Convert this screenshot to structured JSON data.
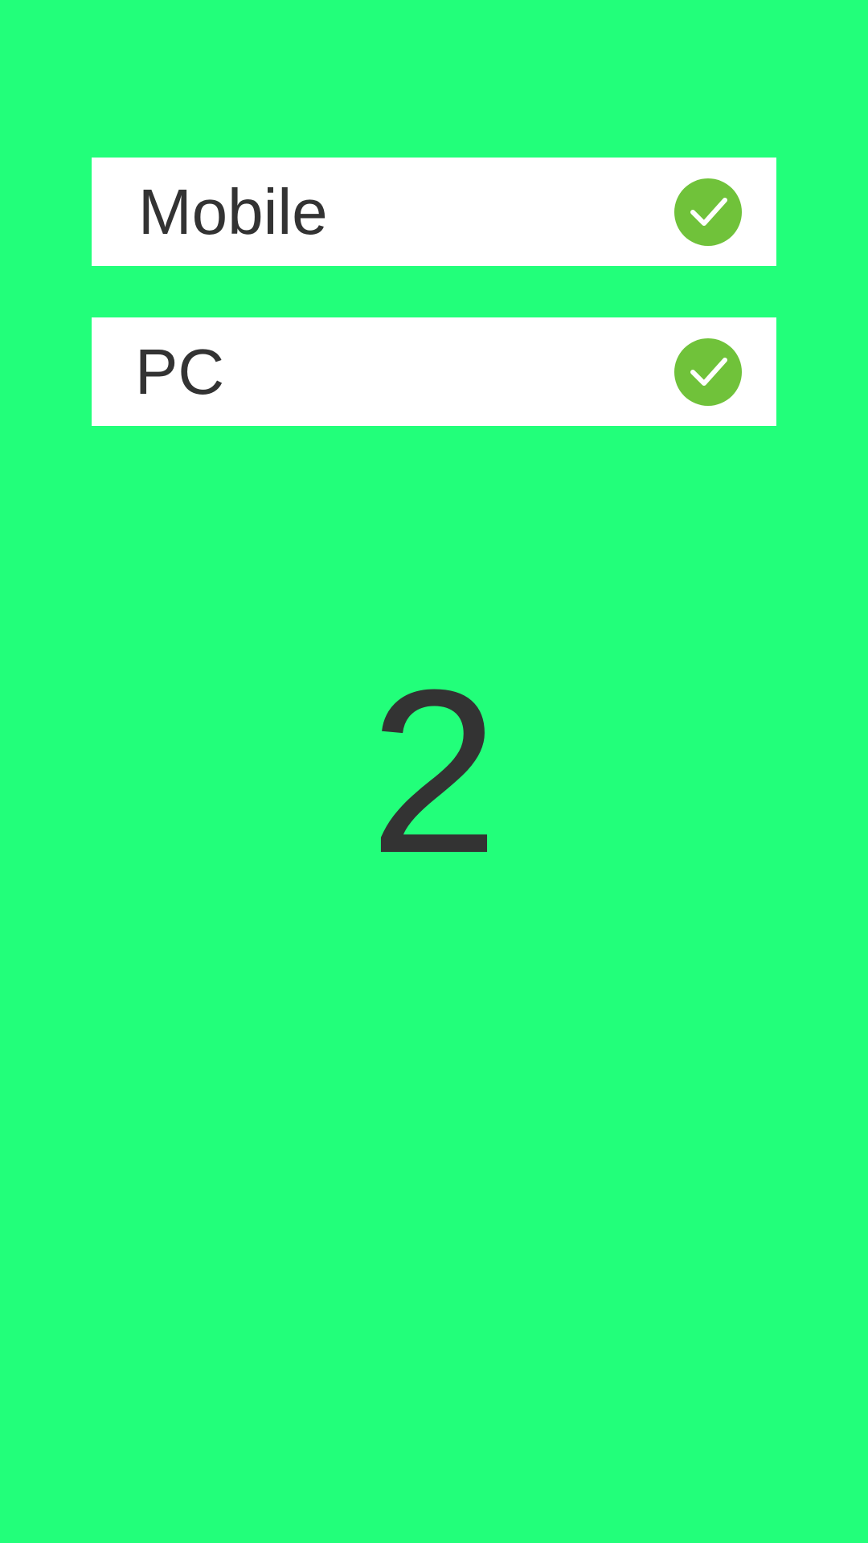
{
  "theme": {
    "background_color": "#22ff7a",
    "card_color": "#ffffff",
    "text_color": "#333333",
    "check_color": "#70c23a",
    "check_mark_color": "#ffffff"
  },
  "options": [
    {
      "label": "Mobile",
      "checked": true,
      "icon": "check-circle-icon"
    },
    {
      "label": "PC",
      "checked": true,
      "icon": "check-circle-icon"
    }
  ],
  "counter": {
    "value": "2"
  }
}
